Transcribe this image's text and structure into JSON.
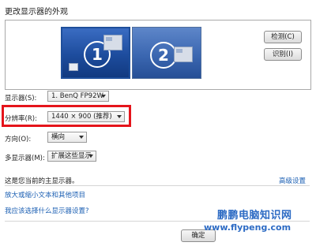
{
  "title": "更改显示器的外观",
  "monitors": [
    {
      "number": "1"
    },
    {
      "number": "2"
    }
  ],
  "buttons": {
    "detect": "检测(C)",
    "identify": "识别(I)",
    "ok": "确定"
  },
  "fields": {
    "display": {
      "label": "显示器(S):",
      "value": "1. BenQ FP92W"
    },
    "resolution": {
      "label": "分辨率(R):",
      "value": "1440 × 900 (推荐)"
    },
    "orientation": {
      "label": "方向(O):",
      "value": "横向"
    },
    "multiple": {
      "label": "多显示器(M):",
      "value": "扩展这些显示"
    }
  },
  "status_text": "这是您当前的主显示器。",
  "advanced_link": "高级设置",
  "links": [
    "放大或缩小文本和其他项目",
    "我应该选择什么显示器设置?"
  ],
  "watermark": {
    "line1": "鹏鹏电脑知识网",
    "line2": "www.flypeng.com"
  }
}
